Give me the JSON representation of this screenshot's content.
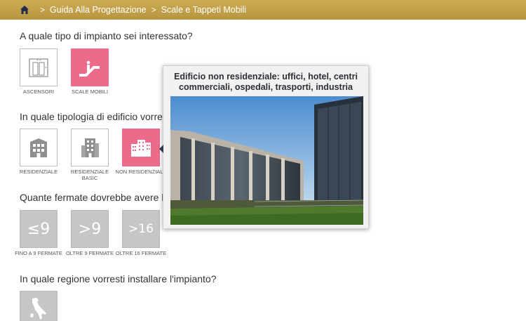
{
  "breadcrumb": {
    "items": [
      "Guida Alla Progettazione",
      "Scale e Tappeti Mobili"
    ],
    "separator": ">"
  },
  "questions": {
    "impianto": "A quale tipo di impianto sei interessato?",
    "edificio": "In quale tipologia di edificio vorresti",
    "fermate": "Quante fermate dovrebbe avere l’as",
    "regione": "In quale regione vorresti installare l'impianto?"
  },
  "impianto_options": [
    {
      "label": "ASCENSORI",
      "icon": "elevator-icon",
      "selected": false
    },
    {
      "label": "SCALE MOBILI",
      "icon": "escalator-icon",
      "selected": true
    }
  ],
  "edificio_options": [
    {
      "label": "RESIDENZIALE",
      "icon": "residential-building-icon",
      "selected": false
    },
    {
      "label": "RESIDENZIALE BASIC",
      "icon": "residential-basic-building-icon",
      "selected": false
    },
    {
      "label": "NON RESIDENZIALE",
      "icon": "office-building-icon",
      "selected": true
    }
  ],
  "fermate_options": [
    {
      "symbol": "≤9",
      "label": "FINO A 9 FERMATE"
    },
    {
      "symbol": ">9",
      "label": "OLTRE 9 FERMATE"
    },
    {
      "symbol": ">16",
      "label": "OLTRE 16 FERMATE"
    }
  ],
  "regione_options": [
    {
      "icon": "italy-map-icon"
    }
  ],
  "popup": {
    "title": "Edificio non residenziale: uffici, hotel, centri commerciali, ospedali, trasporti, industria"
  },
  "colors": {
    "topbar": "#c3a24b",
    "selected": "#ec6b8a",
    "disabled": "#c6c6c6"
  }
}
